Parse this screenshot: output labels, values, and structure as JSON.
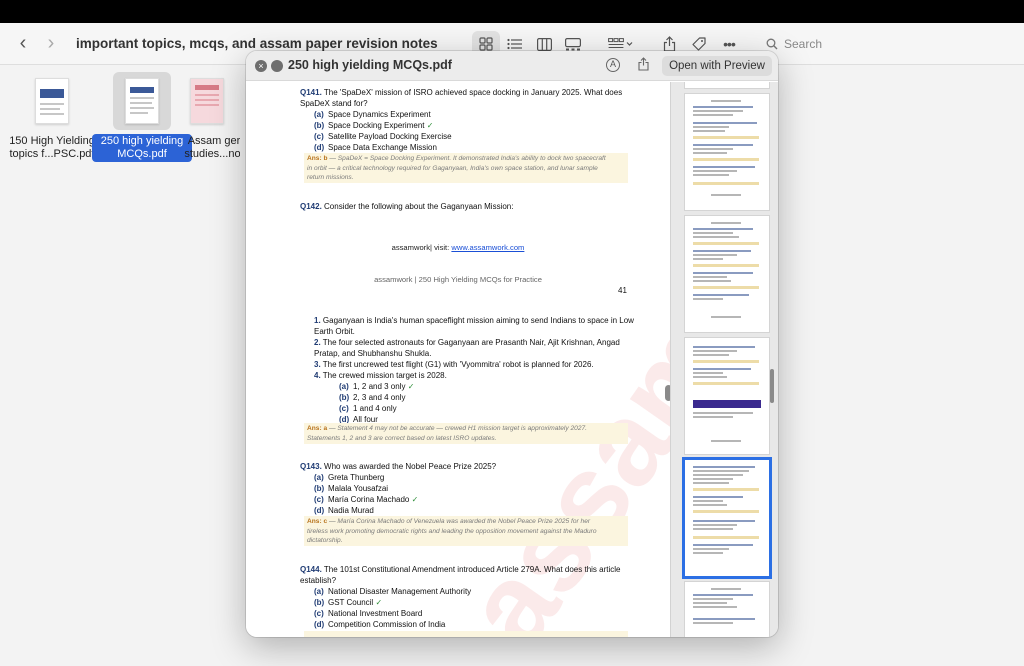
{
  "finder": {
    "folder_title": "important topics, mcqs, and assam paper revision notes",
    "search_placeholder": "Search"
  },
  "files": [
    {
      "name": "150 High Yielding topics f...PSC.pdf",
      "selected": false
    },
    {
      "name": "250 high yielding MCQs.pdf",
      "selected": true
    },
    {
      "name": "Assam ger studies...not",
      "selected": false
    }
  ],
  "quicklook": {
    "title": "250 high yielding MCQs.pdf",
    "open_button": "Open with Preview",
    "markup_glyph": "A"
  },
  "doc": {
    "q141": {
      "num": "Q141.",
      "text1": "The 'SpaDeX' mission of ISRO achieved space docking in January 2025. What does",
      "text2": "SpaDeX stand for?",
      "options": [
        {
          "label": "(a)",
          "text": "Space Dynamics Experiment",
          "check": ""
        },
        {
          "label": "(b)",
          "text": "Space Docking Experiment",
          "check": "✓"
        },
        {
          "label": "(c)",
          "text": "Satellite Payload Docking Exercise",
          "check": ""
        },
        {
          "label": "(d)",
          "text": "Space Data Exchange Mission",
          "check": ""
        }
      ],
      "ans_label": "Ans: b",
      "ans1": " — SpaDeX = Space Docking Experiment. It demonstrated India's ability to dock two spacecraft",
      "ans2": "in orbit — a critical technology required for Gaganyaan, India's own space station, and lunar sample",
      "ans3": "return missions."
    },
    "q142": {
      "num": "Q142.",
      "text": "Consider the following about the Gaganyaan Mission:"
    },
    "page_footer": {
      "site_prefix": "assamwork| visit: ",
      "site_link": "www.assamwork.com",
      "header": "assamwork | 250 High Yielding MCQs for Practice",
      "page_number": "41"
    },
    "q142_statements": [
      {
        "num": "1.",
        "line1": "Gaganyaan is India's human spaceflight mission aiming to send Indians to space in Low",
        "line2": "Earth Orbit."
      },
      {
        "num": "2.",
        "line1": "The four selected astronauts for Gaganyaan are Prasanth Nair, Ajit Krishnan, Angad",
        "line2": "Pratap, and Shubhanshu Shukla."
      },
      {
        "num": "3.",
        "line1": "The first uncrewed test flight (G1) with 'Vyommitra' robot is planned for 2026.",
        "line2": ""
      },
      {
        "num": "4.",
        "line1": "The crewed mission target is 2028.",
        "line2": ""
      }
    ],
    "q142_options": [
      {
        "label": "(a)",
        "text": "1, 2 and 3 only",
        "check": "✓"
      },
      {
        "label": "(b)",
        "text": "2, 3 and 4 only",
        "check": ""
      },
      {
        "label": "(c)",
        "text": "1 and 4 only",
        "check": ""
      },
      {
        "label": "(d)",
        "text": "All four",
        "check": ""
      }
    ],
    "q142_ans": {
      "label": "Ans: a",
      "line1": " — Statement 4 may not be accurate — crewed H1 mission target is approximately 2027.",
      "line2": "Statements 1, 2 and 3 are correct based on latest ISRO updates."
    },
    "q143": {
      "num": "Q143.",
      "text": "Who was awarded the Nobel Peace Prize 2025?",
      "options": [
        {
          "label": "(a)",
          "text": "Greta Thunberg",
          "check": ""
        },
        {
          "label": "(b)",
          "text": "Malala Yousafzai",
          "check": ""
        },
        {
          "label": "(c)",
          "text": "María Corina Machado",
          "check": "✓"
        },
        {
          "label": "(d)",
          "text": "Nadia Murad",
          "check": ""
        }
      ],
      "ans_label": "Ans: c",
      "ans1": " — María Corina Machado of Venezuela was awarded the Nobel Peace Prize 2025 for her",
      "ans2": "tireless work promoting democratic rights and leading the opposition movement against the Maduro",
      "ans3": "dictatorship."
    },
    "q144": {
      "num": "Q144.",
      "text1": "The 101st Constitutional Amendment introduced Article 279A. What does this article",
      "text2": "establish?",
      "options": [
        {
          "label": "(a)",
          "text": "National Disaster Management Authority",
          "check": ""
        },
        {
          "label": "(b)",
          "text": "GST Council",
          "check": "✓"
        },
        {
          "label": "(c)",
          "text": "National Investment Board",
          "check": ""
        },
        {
          "label": "(d)",
          "text": "Competition Commission of India",
          "check": ""
        }
      ]
    },
    "watermark": "assamwork"
  },
  "sidebar": {
    "selected_page_index": 3
  }
}
